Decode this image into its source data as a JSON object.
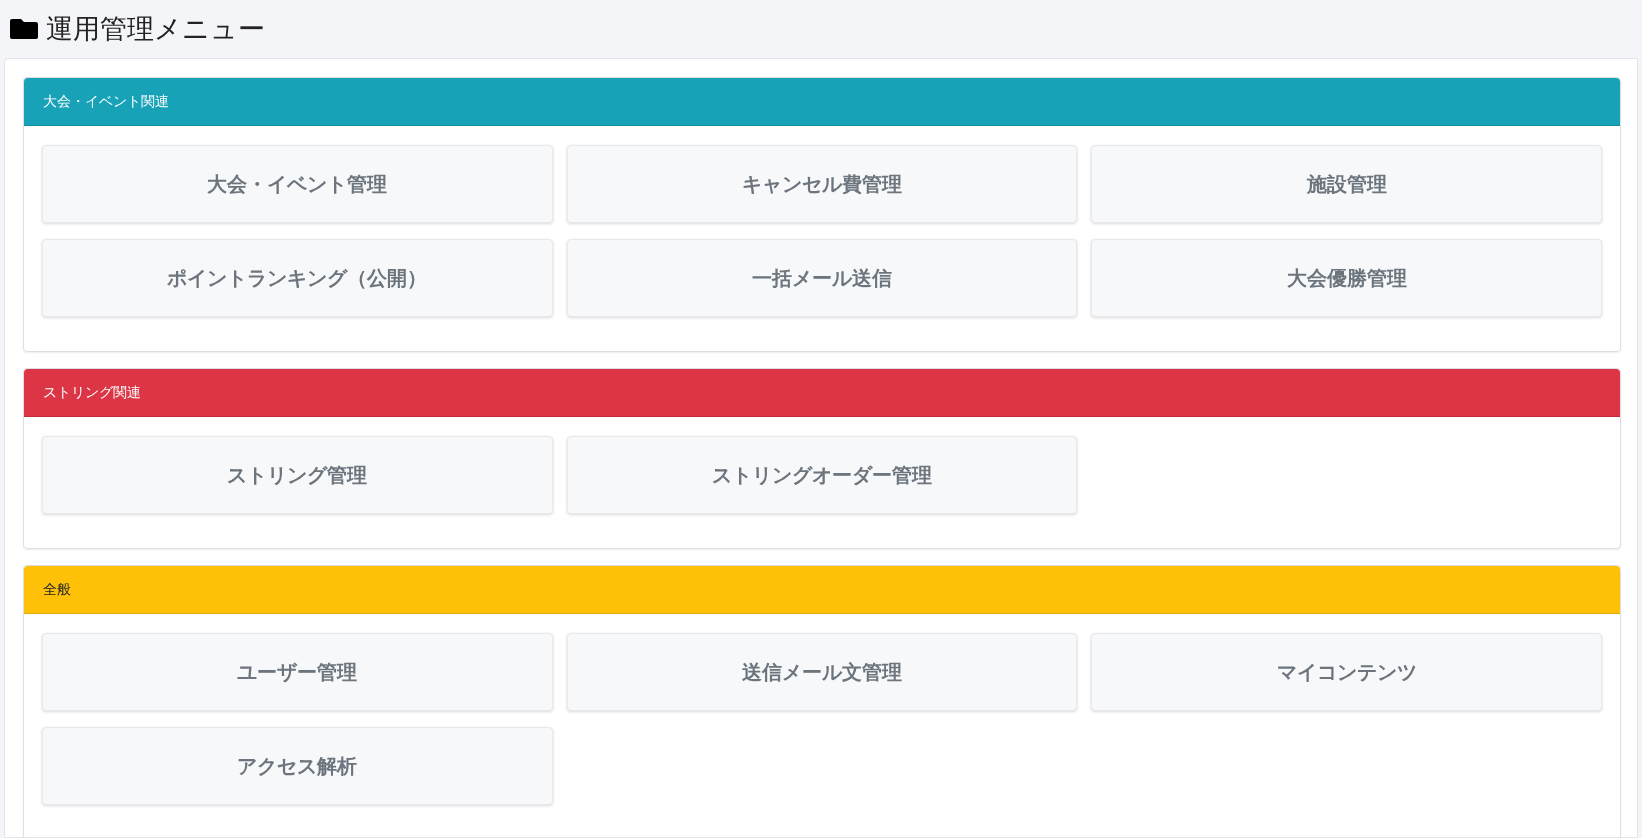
{
  "page": {
    "title": "運用管理メニュー"
  },
  "sections": [
    {
      "title": "大会・イベント関連",
      "color": "#17a2b8",
      "items": [
        "大会・イベント管理",
        "キャンセル費管理",
        "施設管理",
        "ポイントランキング（公開）",
        "一括メール送信",
        "大会優勝管理"
      ]
    },
    {
      "title": "ストリング関連",
      "color": "#dc3545",
      "items": [
        "ストリング管理",
        "ストリングオーダー管理"
      ]
    },
    {
      "title": "全般",
      "color": "#ffc107",
      "items": [
        "ユーザー管理",
        "送信メール文管理",
        "マイコンテンツ",
        "アクセス解析"
      ]
    }
  ]
}
